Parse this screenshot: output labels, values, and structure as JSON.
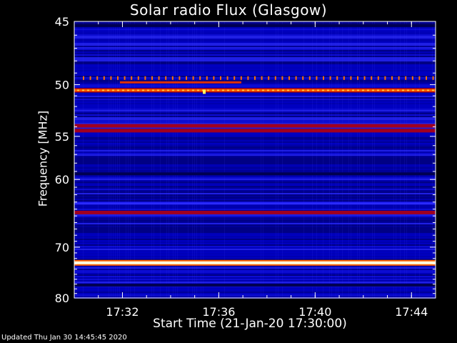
{
  "chart_data": {
    "type": "heatmap",
    "title": "Solar radio Flux (Glasgow)",
    "xlabel": "Start Time (21-Jan-20 17:30:00)",
    "ylabel": "Frequency [MHz]",
    "x_ticks": [
      "17:32",
      "17:36",
      "17:40",
      "17:44"
    ],
    "x_tick_minutes": [
      2,
      6,
      10,
      14
    ],
    "xlim_minutes": [
      0,
      15
    ],
    "y_ticks": [
      45,
      50,
      55,
      60,
      70,
      80
    ],
    "ylim": [
      45,
      80
    ],
    "y_scale": "reciprocal",
    "colormap": [
      "#000060",
      "#0000c0",
      "#2a2af0",
      "#a00020",
      "#e02000",
      "#ff8000",
      "#ffff60",
      "#ffffff"
    ],
    "bands": [
      {
        "freq": 45.3,
        "level": "dark"
      },
      {
        "freq": 49.4,
        "level": "spike-train"
      },
      {
        "freq": 49.8,
        "level": "orange"
      },
      {
        "freq": 50.5,
        "level": "bright"
      },
      {
        "freq": 53.9,
        "level": "red"
      },
      {
        "freq": 54.4,
        "level": "red"
      },
      {
        "freq": 59.3,
        "level": "dark"
      },
      {
        "freq": 63.2,
        "level": "blue"
      },
      {
        "freq": 64.5,
        "level": "red"
      },
      {
        "freq": 72.8,
        "level": "white"
      },
      {
        "freq": 77.2,
        "level": "dark"
      }
    ]
  },
  "footer": "Updated Thu Jan 30 14:45:45 2020"
}
